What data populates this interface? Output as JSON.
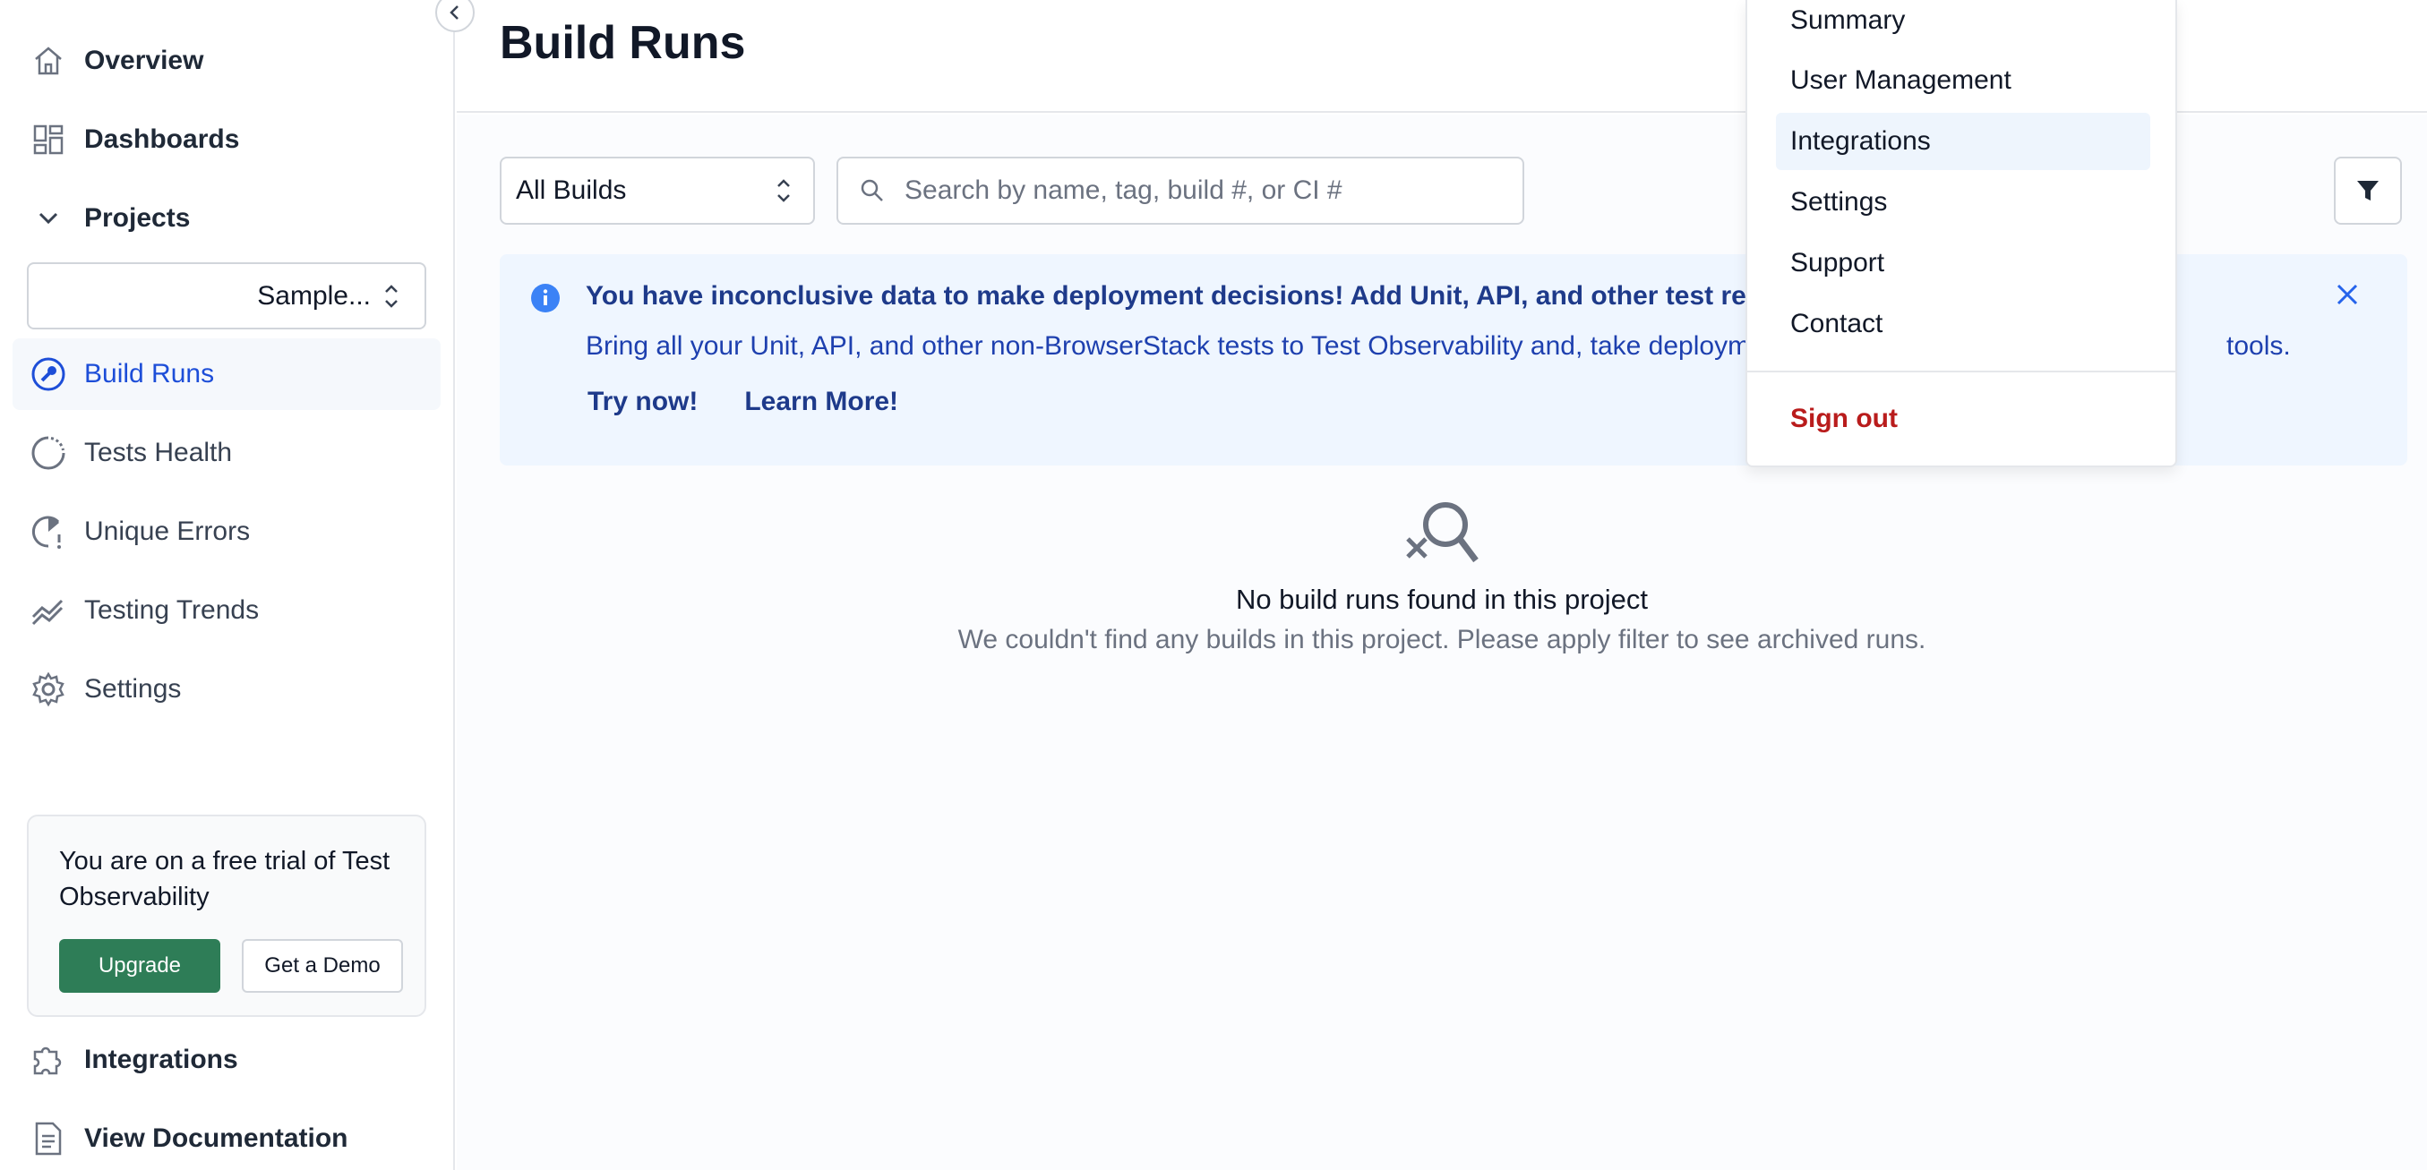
{
  "sidebar": {
    "items": {
      "overview": "Overview",
      "dashboards": "Dashboards",
      "projects": "Projects",
      "build_runs": "Build Runs",
      "tests_health": "Tests Health",
      "unique_errors": "Unique Errors",
      "testing_trends": "Testing Trends",
      "settings": "Settings",
      "integrations": "Integrations",
      "view_documentation": "View Documentation"
    },
    "project_select": {
      "value": "Sample..."
    },
    "trial": {
      "text": "You are on a free trial of Test Observability",
      "upgrade_label": "Upgrade",
      "demo_label": "Get a Demo"
    }
  },
  "header": {
    "title": "Build Runs"
  },
  "toolbar": {
    "builds_select_value": "All Builds",
    "search_placeholder": "Search by name, tag, build #, or CI #"
  },
  "banner": {
    "title": "You have inconclusive data to make deployment decisions! Add Unit, API, and other test results n",
    "body": "Bring all your Unit, API, and other non-BrowserStack tests to Test Observability and, take deploym",
    "body_tail": "tools.",
    "try_now": "Try now!",
    "learn_more": "Learn More!"
  },
  "empty_state": {
    "title": "No build runs found in this project",
    "subtitle": "We couldn't find any builds in this project. Please apply filter to see archived runs."
  },
  "dropdown": {
    "summary": "Summary",
    "user_management": "User Management",
    "integrations": "Integrations",
    "settings": "Settings",
    "support": "Support",
    "contact": "Contact",
    "sign_out": "Sign out"
  },
  "colors": {
    "active_blue": "#1d4ed8",
    "upgrade_green": "#2e7d57",
    "banner_bg": "#eff6ff",
    "signout_red": "#b91c1c"
  }
}
